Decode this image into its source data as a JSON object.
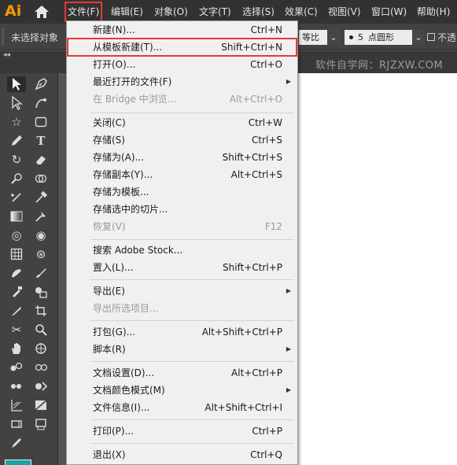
{
  "app": {
    "logo": "Ai"
  },
  "menubar": {
    "items": [
      "文件(F)",
      "编辑(E)",
      "对象(O)",
      "文字(T)",
      "选择(S)",
      "效果(C)",
      "视图(V)",
      "窗口(W)",
      "帮助(H)"
    ]
  },
  "control_bar": {
    "selection_label": "未选择对象",
    "stroke_profile": "等比",
    "brush_size": "5",
    "brush_label": "点圆形",
    "opacity_label": "不透"
  },
  "tab_row": {
    "collapse_glyph": "◂◂"
  },
  "watermark": "软件自学网：RJZXW.COM",
  "toolbar": {
    "tools": [
      "selection-tool",
      "pen-tool",
      "direct-selection-tool",
      "curvature-tool",
      "star-tool",
      "rectangle-tool",
      "pencil-tool",
      "type-tool",
      "rotate-tool",
      "eraser-tool",
      "warp-tool",
      "shape-builder-tool",
      "anchor-point-tool",
      "eyedropper-tool",
      "gradient-tool",
      "blend-tool",
      "spiral-tool",
      "polar-grid-tool",
      "mesh-tool",
      "symbol-sprayer-tool",
      "blob-brush-tool",
      "paintbrush-tool",
      "live-paint-tool",
      "symbol-tool",
      "knife-tool",
      "artboard-tool",
      "scissors-tool",
      "zoom-tool",
      "hand-tool",
      "perspective-grid-tool",
      "live-paint-selection-tool",
      "symbol-shifter-tool",
      "puppet-warp-tool",
      "column-graph-tool",
      "chart-tool",
      "slice-tool",
      "print-tiling-tool",
      "shaper-tool",
      "fill-swatch"
    ]
  },
  "file_menu": {
    "items": [
      {
        "label": "新建(N)...",
        "shortcut": "Ctrl+N"
      },
      {
        "label": "从模板新建(T)...",
        "shortcut": "Shift+Ctrl+N"
      },
      {
        "label": "打开(O)...",
        "shortcut": "Ctrl+O"
      },
      {
        "label": "最近打开的文件(F)",
        "shortcut": ""
      },
      {
        "label": "在 Bridge 中浏览...",
        "shortcut": "Alt+Ctrl+O"
      },
      {
        "label": "关闭(C)",
        "shortcut": "Ctrl+W"
      },
      {
        "label": "存储(S)",
        "shortcut": "Ctrl+S"
      },
      {
        "label": "存储为(A)...",
        "shortcut": "Shift+Ctrl+S"
      },
      {
        "label": "存储副本(Y)...",
        "shortcut": "Alt+Ctrl+S"
      },
      {
        "label": "存储为模板...",
        "shortcut": ""
      },
      {
        "label": "存储选中的切片...",
        "shortcut": ""
      },
      {
        "label": "恢复(V)",
        "shortcut": "F12"
      },
      {
        "label": "搜索 Adobe Stock...",
        "shortcut": ""
      },
      {
        "label": "置入(L)...",
        "shortcut": "Shift+Ctrl+P"
      },
      {
        "label": "导出(E)",
        "shortcut": ""
      },
      {
        "label": "导出所选项目...",
        "shortcut": ""
      },
      {
        "label": "打包(G)...",
        "shortcut": "Alt+Shift+Ctrl+P"
      },
      {
        "label": "脚本(R)",
        "shortcut": ""
      },
      {
        "label": "文档设置(D)...",
        "shortcut": "Alt+Ctrl+P"
      },
      {
        "label": "文档颜色模式(M)",
        "shortcut": ""
      },
      {
        "label": "文件信息(I)...",
        "shortcut": "Alt+Shift+Ctrl+I"
      },
      {
        "label": "打印(P)...",
        "shortcut": "Ctrl+P"
      },
      {
        "label": "退出(X)",
        "shortcut": "Ctrl+Q"
      }
    ]
  },
  "colors": {
    "highlight_box": "#e53935",
    "logo": "#ff9a00",
    "menubar_bg": "#323232",
    "dropdown_bg": "#f0f0f0",
    "fill_swatch": "#1aa3a3"
  }
}
